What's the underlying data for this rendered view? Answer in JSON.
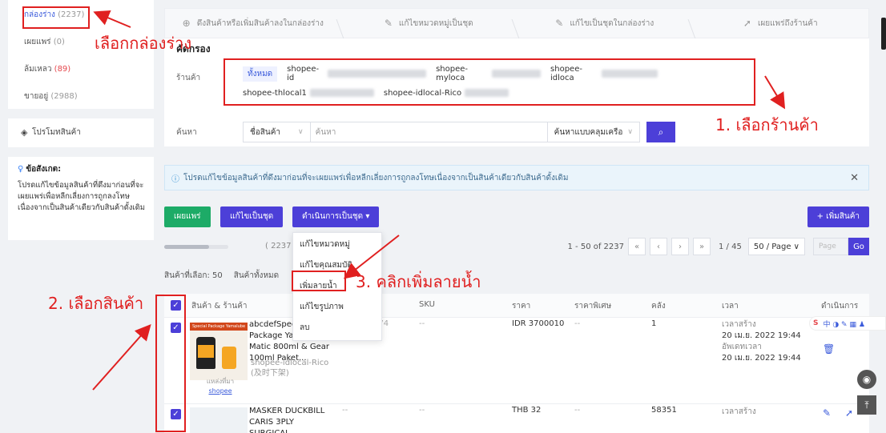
{
  "sidebar": {
    "items": [
      {
        "label": "กล่องร่าง",
        "count": "(2237)"
      },
      {
        "label": "เผยแพร่",
        "count": "(0)"
      },
      {
        "label": "ล้มเหลว",
        "count": "(89)"
      },
      {
        "label": "ขายอยู่",
        "count": "(2988)"
      }
    ],
    "promo_label": "โปรโมทสินค้า",
    "note": {
      "title": "ข้อสังเกต:",
      "body": "โปรดแก้ไขข้อมูลสินค้าที่ดึงมาก่อนที่จะเผยแพร่เพื่อหลีกเลี่ยงการถูกลงโทษเนื่องจากเป็นสินค้าเดียวกับสินค้าดั้งเดิม"
    }
  },
  "steps": [
    {
      "label": "ดึงสินค้าหรือเพิ่มสินค้าลงในกล่องร่าง",
      "icon": "plus-circle-icon"
    },
    {
      "label": "แก้ไขหมวดหมู่เป็นชุด",
      "icon": "edit-icon"
    },
    {
      "label": "แก้ไขเป็นชุดในกล่องร่าง",
      "icon": "edit-icon"
    },
    {
      "label": "เผยแพร่ถึงร้านค้า",
      "icon": "send-icon"
    }
  ],
  "filter": {
    "title": "คัดกรอง",
    "shop_label": "ร้านค้า",
    "shops_line1": [
      "ทั้งหมด",
      "shopee-id",
      "shopee-myloca",
      "shopee-idloca"
    ],
    "shops_line2": [
      "shopee-thlocal1",
      "shopee-idlocal-Rico"
    ],
    "search_label": "ค้นหา",
    "search_field": "ชื่อสินค้า",
    "search_placeholder": "ค้นหา",
    "search_mode": "ค้นหาแบบคลุมเครือ"
  },
  "info_text": "โปรดแก้ไขข้อมูลสินค้าที่ดึงมาก่อนที่จะเผยแพร่เพื่อหลีกเลี่ยงการถูกลงโทษเนื่องจากเป็นสินค้าเดียวกับสินค้าดั้งเดิม",
  "toolbar": {
    "publish": "เผยแพร่",
    "batch_edit": "แก้ไขเป็นชุด",
    "batch_action": "ดำเนินการเป็นชุด",
    "add_product": "+ เพิ่มสินค้า"
  },
  "dropdown": [
    "แก้ไขหมวดหมู่",
    "แก้ไขคุณสมบัติ",
    "เพิ่มลายน้ำ",
    "แก้ไขรูปภาพ",
    "ลบ"
  ],
  "progress": {
    "text": "( 2237 )",
    "fraction": 0.7
  },
  "pager": {
    "range": "1 - 50 of 2237",
    "page": "1 / 45",
    "per_page": "50 / Page",
    "input_placeholder": "Page",
    "go": "Go"
  },
  "selection": {
    "selected": "สินค้าที่เลือก: 50",
    "all": "สินค้าทั้งหมด"
  },
  "table": {
    "headers": [
      "สินค้า & ร้านค้า",
      "SKU",
      "ราคา",
      "ราคาพิเศษ",
      "คลัง",
      "เวลา",
      "ดำเนินการ"
    ],
    "rows": [
      {
        "name": "abcdefSpecial Package Yamalube Matic 800ml & Gear 100ml Paket...",
        "shop": "shopee-idlocal-Rico (及时下架)",
        "source_label": "แหล่งที่มา",
        "source": "shopee",
        "sku_id": "…4200…74",
        "sku": "--",
        "price": "IDR 3700010",
        "special": "--",
        "stock": "1",
        "created_label": "เวลาสร้าง",
        "created": "20 เม.ย. 2022 19:44",
        "updated_label": "อัพเดทเวลา",
        "updated": "20 เม.ย. 2022 19:44",
        "img_label": "Special Package Yamalube"
      },
      {
        "name": "MASKER DUCKBILL CARIS 3PLY SURGICAL",
        "sku_id": "--",
        "sku": "--",
        "price": "THB 32",
        "special": "--",
        "stock": "58351",
        "created_label": "เวลาสร้าง"
      }
    ]
  },
  "annotations": {
    "draft_box": "เลือกกล่องร่าง",
    "step1": "1. เลือกร้านค้า",
    "step2": "2. เลือกสินค้า",
    "step3": "3. คลิกเพิ่มลายน้ำ"
  },
  "colors": {
    "accent": "#4c3fd8",
    "green": "#1dab67",
    "annotation": "#e02020"
  }
}
